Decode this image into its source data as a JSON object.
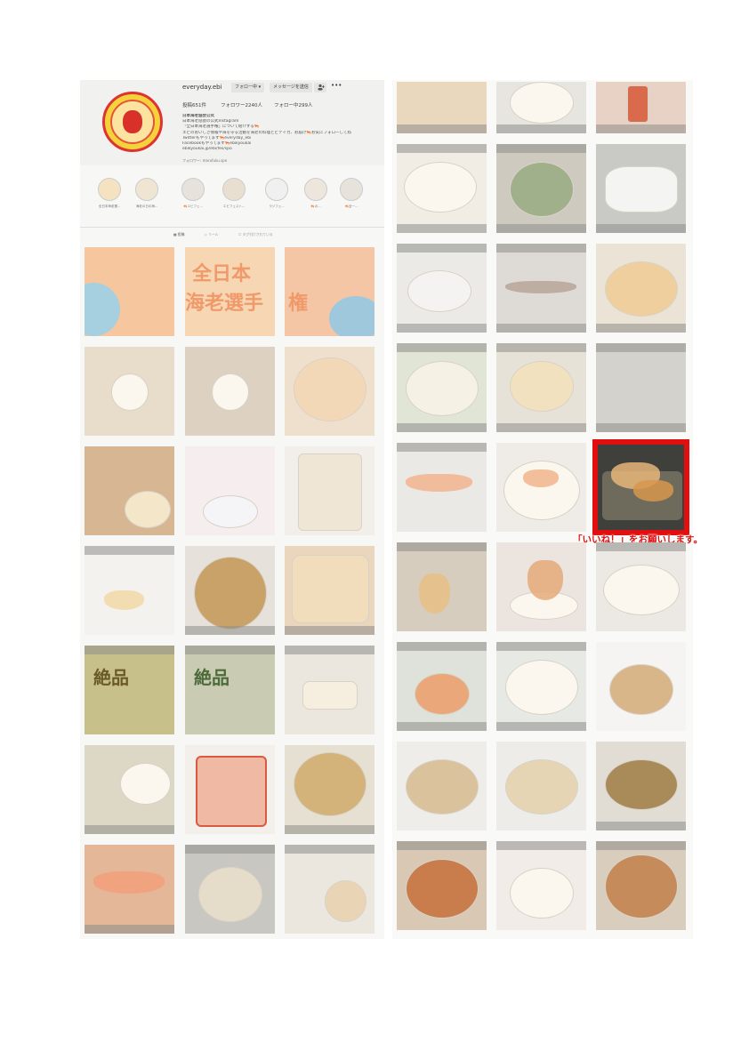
{
  "profile": {
    "username": "everyday.ebi",
    "follow_button": "フォロー中 ▾",
    "message_button": "メッセージを送信",
    "add_user_icon": "person-add-icon",
    "more_icon": "•••",
    "posts": "投稿651件",
    "followers": "フォロワー2240人",
    "following": "フォロー中299人",
    "bio_lines": [
      "日本海老協会公式",
      "日本海老協会の公式Instagram",
      "「全日本海老選手権」について紹介する🦐",
      "エビのおいしさ情報や海を守る活動を海老の料理とビデイカ、お届け🦐お気にフォローしてね",
      "Twitterもやってます🦐everyday_ebi",
      "Facebookもやってます🦐ebikyoukai",
      "ebikyoukai.jp/ebi/fes/spo"
    ],
    "followed_by": "フォロワー: marufuku.spe"
  },
  "highlights": [
    "全日本海老選...",
    "海老の日の海...",
    "🦐エビフェ...",
    "エビフェスト...",
    "ラジフェ...",
    "🦐の...",
    "🦐全一..."
  ],
  "tabs": [
    "▦ 投稿",
    "▷ リール",
    "☐ タグ付けされている"
  ],
  "caption": "「いいね！」をお願いします。",
  "accent_color": "#e10f0f"
}
